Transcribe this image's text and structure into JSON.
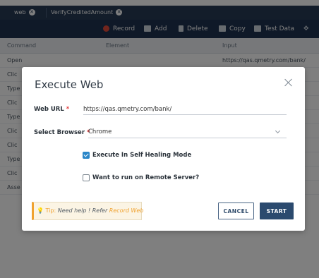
{
  "tabs": [
    {
      "label": "web"
    },
    {
      "label": "VerifyCreditedAmount"
    }
  ],
  "toolbar": {
    "record_label": "Record",
    "add_label": "Add",
    "delete_label": "Delete",
    "copy_label": "Copy",
    "test_data_label": "Test Data"
  },
  "command_table": {
    "headers": [
      "Command",
      "Element",
      "Input"
    ],
    "rows": [
      {
        "command": "Open",
        "input": "https://qas.qmetry.com/bank/"
      },
      {
        "command": "Clic",
        "input": ""
      },
      {
        "command": "Type",
        "input": ""
      },
      {
        "command": "Clic",
        "input": ""
      },
      {
        "command": "Type",
        "input": ""
      },
      {
        "command": "Clic",
        "input": ""
      },
      {
        "command": "Clic",
        "input": ""
      },
      {
        "command": "Type",
        "input": ""
      },
      {
        "command": "Clic",
        "input": ""
      },
      {
        "command": "Asse",
        "input": ""
      }
    ]
  },
  "modal": {
    "title": "Execute Web",
    "url_label": "Web URL",
    "url_value": "https://qas.qmetry.com/bank/",
    "browser_label": "Select Browser",
    "browser_value": "Chrome",
    "self_healing_label": "Execute In Self Healing Mode",
    "self_healing_checked": true,
    "remote_label": "Want to run on Remote Server?",
    "remote_checked": false,
    "tip": {
      "label": "Tip:",
      "text": "Need help ! Refer",
      "link": "Record Web"
    },
    "cancel_label": "CANCEL",
    "start_label": "START"
  },
  "colors": {
    "accent": "#2b4a6e",
    "checkbox": "#2a86c8",
    "tip": "#f0a230",
    "required": "#e23b3b"
  }
}
